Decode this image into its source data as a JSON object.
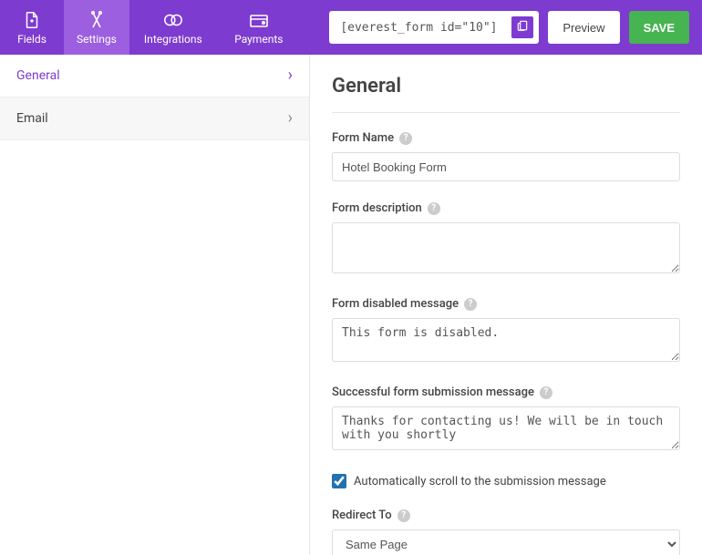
{
  "topbar": {
    "tabs": {
      "fields": "Fields",
      "settings": "Settings",
      "integrations": "Integrations",
      "payments": "Payments"
    },
    "shortcode": "[everest_form id=\"10\"]",
    "preview": "Preview",
    "save": "SAVE"
  },
  "sidebar": {
    "general": "General",
    "email": "Email"
  },
  "content": {
    "title": "General",
    "form_name_label": "Form Name",
    "form_name_value": "Hotel Booking Form",
    "form_desc_label": "Form description",
    "form_desc_value": "",
    "disabled_label": "Form disabled message",
    "disabled_value": "This form is disabled.",
    "success_label": "Successful form submission message",
    "success_value": "Thanks for contacting us! We will be in touch with you shortly",
    "autoscroll_label": "Automatically scroll to the submission message",
    "redirect_label": "Redirect To",
    "redirect_value": "Same Page"
  }
}
